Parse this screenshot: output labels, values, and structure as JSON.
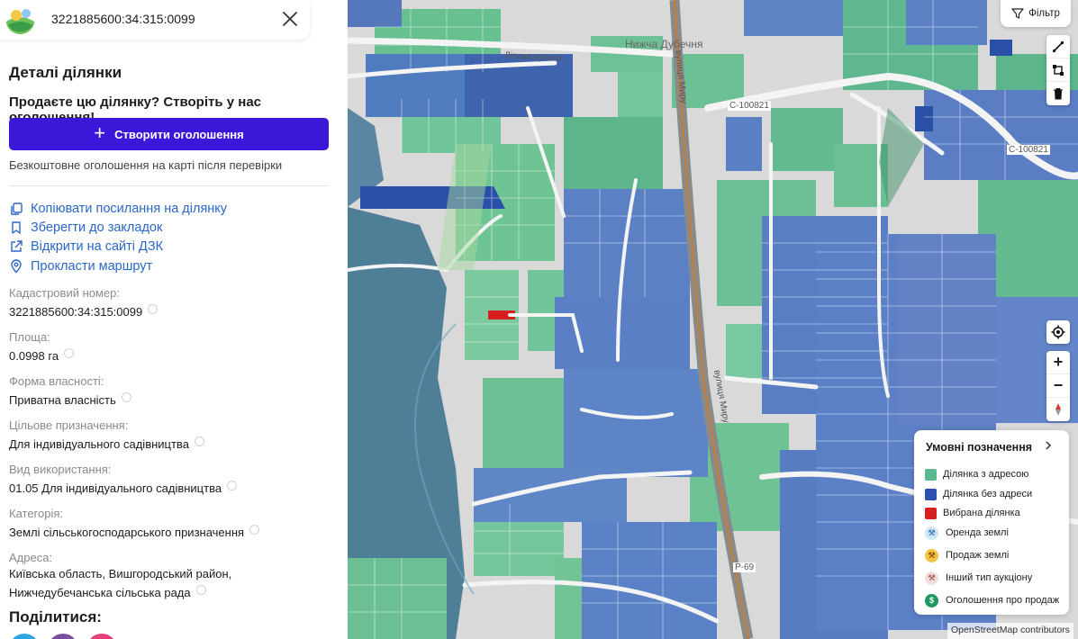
{
  "header": {
    "cadastral_number": "3221885600:34:315:0099"
  },
  "details": {
    "title": "Деталі ділянки",
    "sell_prompt": "Продаєте цю ділянку? Створіть у нас оголошення!",
    "create_button": "Створити оголошення",
    "free_note": "Безкоштовне оголошення на карті після перевірки"
  },
  "actions": [
    {
      "label": "Копіювати посилання на ділянку",
      "icon": "copy-icon"
    },
    {
      "label": "Зберегти до закладок",
      "icon": "bookmark-icon"
    },
    {
      "label": "Відкрити на сайті ДЗК",
      "icon": "external-link-icon"
    },
    {
      "label": "Прокласти маршрут",
      "icon": "location-pin-icon"
    }
  ],
  "fields": [
    {
      "label": "Кадастровий номер:",
      "value": "3221885600:34:315:0099"
    },
    {
      "label": "Площа:",
      "value": "0.0998 га"
    },
    {
      "label": "Форма власності:",
      "value": "Приватна власність"
    },
    {
      "label": "Цільове призначення:",
      "value": "Для індивідуального садівництва"
    },
    {
      "label": "Вид використання:",
      "value": "01.05 Для індивідуального садівництва"
    },
    {
      "label": "Категорія:",
      "value": "Землі сільськогосподарського призначення"
    },
    {
      "label": "Адреса:",
      "value_line1": "Київська область, Вишгородський район,",
      "value_line2": "Нижчедубечанська сільська рада"
    }
  ],
  "share": {
    "title": "Поділитися:"
  },
  "map": {
    "place_label": "Нижча Дубечня",
    "street_labels": [
      "Лісова вулиця",
      "вулиця Миру",
      "вулиця Миру"
    ],
    "road_labels": [
      "С-100821",
      "С-100821",
      "Р-69"
    ],
    "filter_label": "Фільтр",
    "attribution": "OpenStreetMap contributors"
  },
  "legend": {
    "title": "Умовні позначення",
    "items": [
      {
        "label": "Ділянка з адресою",
        "color": "#5cb88f"
      },
      {
        "label": "Ділянка без адреси",
        "color": "#2c4fb0"
      },
      {
        "label": "Вибрана ділянка",
        "color": "#d81f1f"
      },
      {
        "label": "Оренда землі",
        "icon": "rent-icon",
        "color": "#cfe6f7"
      },
      {
        "label": "Продаж землі",
        "icon": "sale-icon",
        "color": "#f6c043"
      },
      {
        "label": "Інший тип аукціону",
        "icon": "auction-icon",
        "color": "#f1dede"
      },
      {
        "label": "Оголошення про продаж",
        "icon": "dollar-icon",
        "color": "#1d9a5f"
      }
    ]
  },
  "colors": {
    "accent": "#3d17d9",
    "link": "#2a67c9"
  }
}
